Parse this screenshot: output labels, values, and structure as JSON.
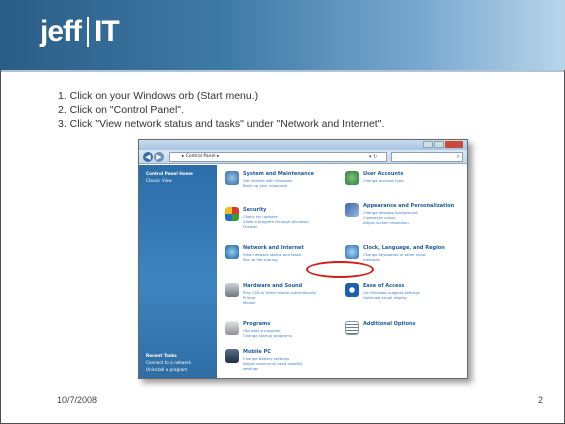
{
  "slide": {
    "logo_part1": "jeff",
    "logo_part2": "IT",
    "steps": [
      "1. Click on your Windows orb (Start menu.)",
      "2. Click on \"Control Panel\".",
      "3. Click \"View network status and tasks\" under \"Network and Internet\"."
    ],
    "date": "10/7/2008",
    "page_number": "2"
  },
  "screenshot": {
    "address": "▸ Control Panel ▸",
    "sidebar": {
      "home": "Control Panel Home",
      "classic": "Classic View",
      "recent_heading": "Recent Tasks",
      "recent_1": "Connect to a network",
      "recent_2": "Uninstall a program"
    },
    "categories": {
      "system": {
        "title": "System and Maintenance",
        "sub": [
          "Get started with Windows",
          "Back up your computer"
        ]
      },
      "security": {
        "title": "Security",
        "sub": [
          "Check for updates",
          "Allow a program through Windows",
          "Firewall"
        ]
      },
      "network": {
        "title": "Network and Internet",
        "sub": [
          "View network status and tasks",
          "Set up file sharing"
        ]
      },
      "hardware": {
        "title": "Hardware and Sound",
        "sub": [
          "Play CDs or other media automatically",
          "Printer",
          "Mouse"
        ]
      },
      "programs": {
        "title": "Programs",
        "sub": [
          "Uninstall a program",
          "Change startup programs"
        ]
      },
      "mobile": {
        "title": "Mobile PC",
        "sub": [
          "Change battery settings",
          "Adjust commonly used mobility",
          "settings"
        ]
      },
      "users": {
        "title": "User Accounts",
        "sub": [
          "Change account type"
        ]
      },
      "appearance": {
        "title": "Appearance and Personalization",
        "sub": [
          "Change desktop background",
          "Customize colors",
          "Adjust screen resolution"
        ]
      },
      "clock": {
        "title": "Clock, Language, and Region",
        "sub": [
          "Change keyboards or other input",
          "methods"
        ]
      },
      "ease": {
        "title": "Ease of Access",
        "sub": [
          "Let Windows suggest settings",
          "Optimize visual display"
        ]
      },
      "additional": {
        "title": "Additional Options",
        "sub": []
      }
    }
  },
  "colors": {
    "header_start": "#2a5d86",
    "header_end": "#b8d5ea",
    "highlight": "#d1201a",
    "cp_link": "#1d5a9c"
  }
}
